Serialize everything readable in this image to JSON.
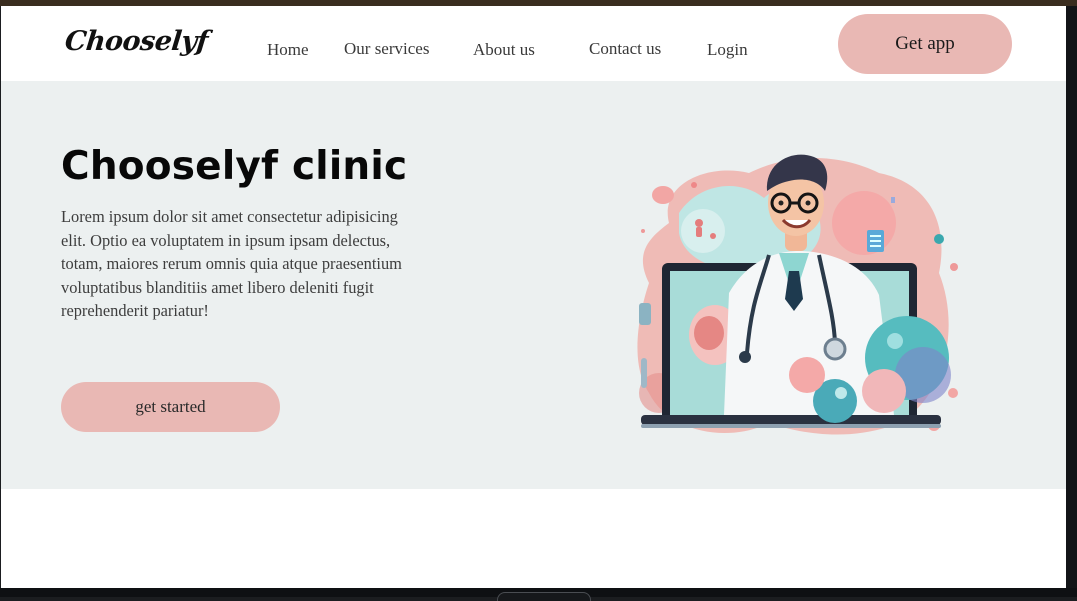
{
  "brand": {
    "logo_text": "Chooselyf"
  },
  "nav": {
    "links": [
      {
        "label": "Home"
      },
      {
        "label": "Our services"
      },
      {
        "label": "About us"
      },
      {
        "label": "Contact us"
      },
      {
        "label": "Login"
      }
    ],
    "cta_label": "Get app"
  },
  "hero": {
    "title": "Chooselyf clinic",
    "description": "Lorem ipsum dolor sit amet consectetur adipisicing elit. Optio ea voluptatem in ipsum ipsam delectus, totam, maiores rerum omnis quia atque praesentium voluptatibus blanditiis amet libero deleniti fugit reprehenderit pariatur!",
    "button_label": "get started"
  },
  "colors": {
    "accent_pink": "#e9b8b4",
    "hero_background": "#ecf0f0",
    "teal": "#5fc2c0"
  }
}
